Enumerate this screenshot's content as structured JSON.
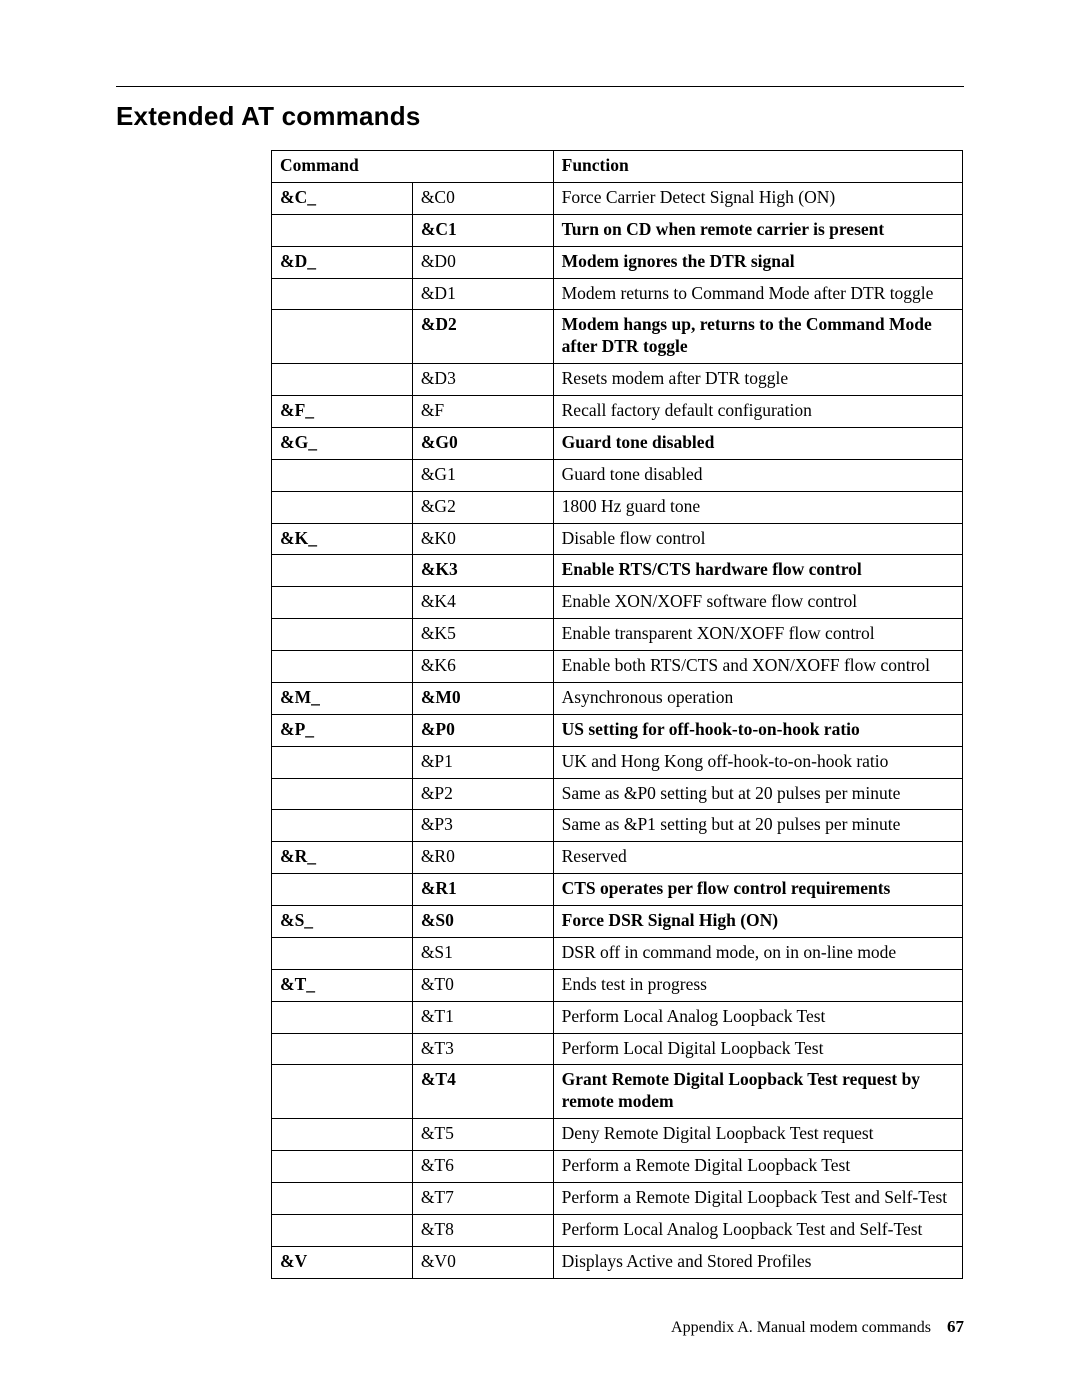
{
  "title": "Extended AT commands",
  "headers": {
    "command": "Command",
    "function": "Function"
  },
  "rows": [
    {
      "group": "&C_",
      "group_bold": true,
      "cmd": "&C0",
      "cmd_bold": false,
      "fn": "Force Carrier Detect Signal High (ON)",
      "fn_bold": false
    },
    {
      "group": "",
      "group_bold": false,
      "cmd": "&C1",
      "cmd_bold": true,
      "fn": "Turn on CD when remote carrier is present",
      "fn_bold": true
    },
    {
      "group": "&D_",
      "group_bold": true,
      "cmd": "&D0",
      "cmd_bold": false,
      "fn": "Modem ignores the DTR signal",
      "fn_bold": true
    },
    {
      "group": "",
      "group_bold": false,
      "cmd": "&D1",
      "cmd_bold": false,
      "fn": "Modem returns to Command Mode after DTR toggle",
      "fn_bold": false
    },
    {
      "group": "",
      "group_bold": false,
      "cmd": "&D2",
      "cmd_bold": true,
      "fn": "Modem hangs up, returns to the Command Mode after DTR toggle",
      "fn_bold": true
    },
    {
      "group": "",
      "group_bold": false,
      "cmd": "&D3",
      "cmd_bold": false,
      "fn": "Resets modem after DTR toggle",
      "fn_bold": false
    },
    {
      "group": "&F_",
      "group_bold": true,
      "cmd": "&F",
      "cmd_bold": false,
      "fn": "Recall factory default configuration",
      "fn_bold": false
    },
    {
      "group": "&G_",
      "group_bold": true,
      "cmd": "&G0",
      "cmd_bold": true,
      "fn": "Guard tone disabled",
      "fn_bold": true
    },
    {
      "group": "",
      "group_bold": false,
      "cmd": "&G1",
      "cmd_bold": false,
      "fn": "Guard tone disabled",
      "fn_bold": false
    },
    {
      "group": "",
      "group_bold": false,
      "cmd": "&G2",
      "cmd_bold": false,
      "fn": "1800 Hz guard tone",
      "fn_bold": false
    },
    {
      "group": "&K_",
      "group_bold": true,
      "cmd": "&K0",
      "cmd_bold": false,
      "fn": "Disable flow control",
      "fn_bold": false
    },
    {
      "group": "",
      "group_bold": false,
      "cmd": "&K3",
      "cmd_bold": true,
      "fn": "Enable RTS/CTS hardware flow control",
      "fn_bold": true
    },
    {
      "group": "",
      "group_bold": false,
      "cmd": "&K4",
      "cmd_bold": false,
      "fn": "Enable XON/XOFF software flow control",
      "fn_bold": false
    },
    {
      "group": "",
      "group_bold": false,
      "cmd": "&K5",
      "cmd_bold": false,
      "fn": "Enable transparent XON/XOFF flow control",
      "fn_bold": false
    },
    {
      "group": "",
      "group_bold": false,
      "cmd": "&K6",
      "cmd_bold": false,
      "fn": "Enable both RTS/CTS and XON/XOFF flow control",
      "fn_bold": false
    },
    {
      "group": "&M_",
      "group_bold": true,
      "cmd": "&M0",
      "cmd_bold": true,
      "fn": "Asynchronous operation",
      "fn_bold": false
    },
    {
      "group": "&P_",
      "group_bold": true,
      "cmd": "&P0",
      "cmd_bold": true,
      "fn": "US setting for off-hook-to-on-hook ratio",
      "fn_bold": true
    },
    {
      "group": "",
      "group_bold": false,
      "cmd": "&P1",
      "cmd_bold": false,
      "fn": "UK and Hong Kong off-hook-to-on-hook ratio",
      "fn_bold": false
    },
    {
      "group": "",
      "group_bold": false,
      "cmd": "&P2",
      "cmd_bold": false,
      "fn": "Same as &P0 setting but at 20 pulses per minute",
      "fn_bold": false
    },
    {
      "group": "",
      "group_bold": false,
      "cmd": "&P3",
      "cmd_bold": false,
      "fn": "Same as &P1 setting but at 20 pulses per minute",
      "fn_bold": false
    },
    {
      "group": "&R_",
      "group_bold": true,
      "cmd": "&R0",
      "cmd_bold": false,
      "fn": "Reserved",
      "fn_bold": false
    },
    {
      "group": "",
      "group_bold": false,
      "cmd": "&R1",
      "cmd_bold": true,
      "fn": "CTS operates per flow control requirements",
      "fn_bold": true
    },
    {
      "group": "&S_",
      "group_bold": true,
      "cmd": "&S0",
      "cmd_bold": true,
      "fn": "Force DSR Signal High (ON)",
      "fn_bold": true
    },
    {
      "group": "",
      "group_bold": false,
      "cmd": "&S1",
      "cmd_bold": false,
      "fn": "DSR off in command mode, on in on-line mode",
      "fn_bold": false
    },
    {
      "group": "&T_",
      "group_bold": true,
      "cmd": "&T0",
      "cmd_bold": false,
      "fn": "Ends test in progress",
      "fn_bold": false
    },
    {
      "group": "",
      "group_bold": false,
      "cmd": "&T1",
      "cmd_bold": false,
      "fn": "Perform Local Analog Loopback Test",
      "fn_bold": false
    },
    {
      "group": "",
      "group_bold": false,
      "cmd": "&T3",
      "cmd_bold": false,
      "fn": "Perform Local Digital Loopback Test",
      "fn_bold": false
    },
    {
      "group": "",
      "group_bold": false,
      "cmd": "&T4",
      "cmd_bold": true,
      "fn": "Grant Remote Digital Loopback Test request by remote modem",
      "fn_bold": true
    },
    {
      "group": "",
      "group_bold": false,
      "cmd": "&T5",
      "cmd_bold": false,
      "fn": "Deny Remote Digital Loopback Test request",
      "fn_bold": false
    },
    {
      "group": "",
      "group_bold": false,
      "cmd": "&T6",
      "cmd_bold": false,
      "fn": "Perform a Remote Digital Loopback Test",
      "fn_bold": false
    },
    {
      "group": "",
      "group_bold": false,
      "cmd": "&T7",
      "cmd_bold": false,
      "fn": "Perform a Remote Digital Loopback Test and Self-Test",
      "fn_bold": false
    },
    {
      "group": "",
      "group_bold": false,
      "cmd": "&T8",
      "cmd_bold": false,
      "fn": "Perform Local Analog Loopback Test and Self-Test",
      "fn_bold": false
    },
    {
      "group": "&V",
      "group_bold": true,
      "cmd": "&V0",
      "cmd_bold": false,
      "fn": "Displays Active and Stored Profiles",
      "fn_bold": false
    }
  ],
  "footer": {
    "appendix": "Appendix A. Manual modem commands",
    "page": "67"
  }
}
